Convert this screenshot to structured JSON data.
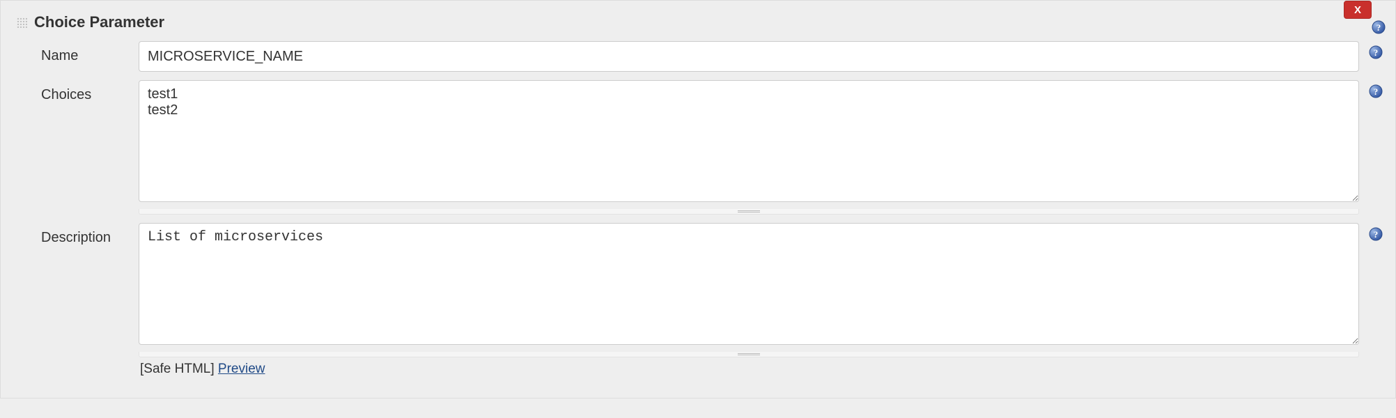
{
  "header": {
    "title": "Choice Parameter",
    "close_label": "X"
  },
  "fields": {
    "name": {
      "label": "Name",
      "value": "MICROSERVICE_NAME"
    },
    "choices": {
      "label": "Choices",
      "value": "test1\ntest2"
    },
    "description": {
      "label": "Description",
      "value": "List of microservices",
      "safe_html_label": "[Safe HTML] ",
      "preview_label": "Preview"
    }
  }
}
